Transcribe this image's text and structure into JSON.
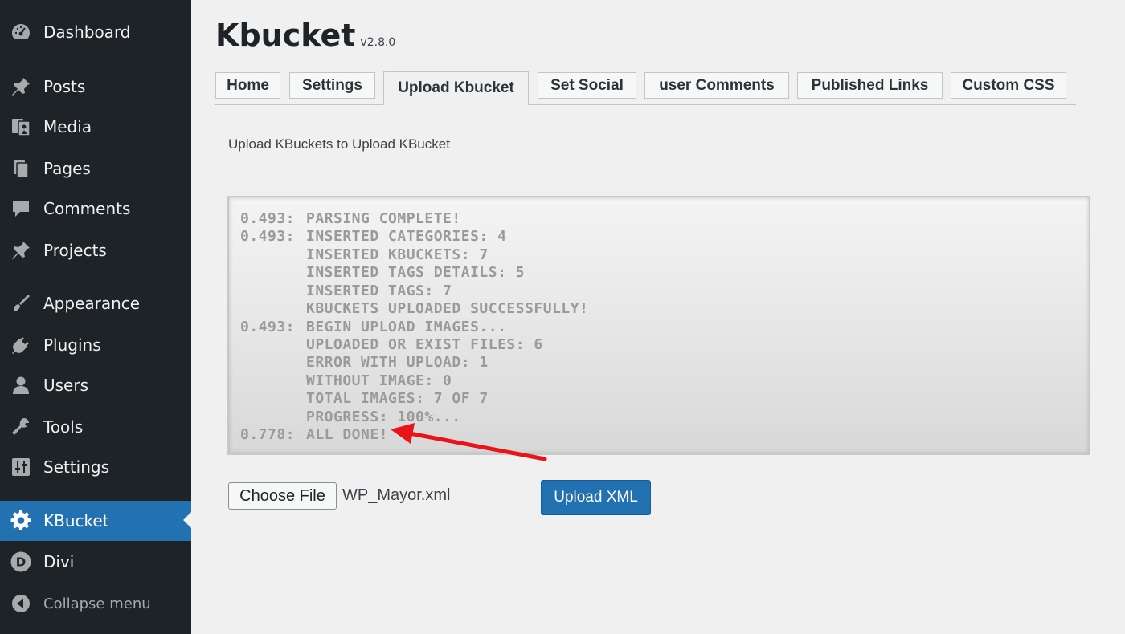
{
  "sidebar": {
    "items": [
      {
        "label": "Dashboard",
        "icon": "dashboard-icon"
      },
      {
        "label": "Posts",
        "icon": "pin-icon"
      },
      {
        "label": "Media",
        "icon": "media-icon"
      },
      {
        "label": "Pages",
        "icon": "pages-icon"
      },
      {
        "label": "Comments",
        "icon": "comment-icon"
      },
      {
        "label": "Projects",
        "icon": "pin-icon"
      },
      {
        "label": "Appearance",
        "icon": "brush-icon"
      },
      {
        "label": "Plugins",
        "icon": "plug-icon"
      },
      {
        "label": "Users",
        "icon": "user-icon"
      },
      {
        "label": "Tools",
        "icon": "wrench-icon"
      },
      {
        "label": "Settings",
        "icon": "sliders-icon"
      },
      {
        "label": "KBucket",
        "icon": "gear-icon",
        "active": true
      },
      {
        "label": "Divi",
        "icon": "divi-icon"
      }
    ],
    "collapse_label": "Collapse menu"
  },
  "header": {
    "title": "Kbucket",
    "version": "v2.8.0"
  },
  "tabs": [
    "Home",
    "Settings",
    "Upload Kbucket",
    "Set Social",
    "user Comments",
    "Published Links",
    "Custom CSS"
  ],
  "active_tab": "Upload Kbucket",
  "description": "Upload KBuckets to Upload KBucket",
  "log": [
    {
      "time": "0.493:",
      "text": "PARSING COMPLETE!"
    },
    {
      "time": "0.493:",
      "text": "INSERTED CATEGORIES: 4"
    },
    {
      "time": "",
      "text": "INSERTED KBUCKETS: 7"
    },
    {
      "time": "",
      "text": "INSERTED TAGS DETAILS: 5"
    },
    {
      "time": "",
      "text": "INSERTED TAGS: 7"
    },
    {
      "time": "",
      "text": "KBUCKETS UPLOADED SUCCESSFULLY!"
    },
    {
      "time": "0.493:",
      "text": "BEGIN UPLOAD IMAGES..."
    },
    {
      "time": "",
      "text": "UPLOADED OR EXIST FILES: 6"
    },
    {
      "time": "",
      "text": "ERROR WITH UPLOAD: 1"
    },
    {
      "time": "",
      "text": "WITHOUT IMAGE: 0"
    },
    {
      "time": "",
      "text": "TOTAL IMAGES: 7 OF 7"
    },
    {
      "time": "",
      "text": "PROGRESS: 100%..."
    },
    {
      "time": "0.778:",
      "text": "ALL DONE!"
    }
  ],
  "file_input": {
    "button_label": "Choose File",
    "file_name": "WP_Mayor.xml"
  },
  "upload_button": "Upload XML",
  "colors": {
    "sidebar_bg": "#1d2327",
    "accent": "#2271b1",
    "annotation_arrow": "#e8141a"
  }
}
